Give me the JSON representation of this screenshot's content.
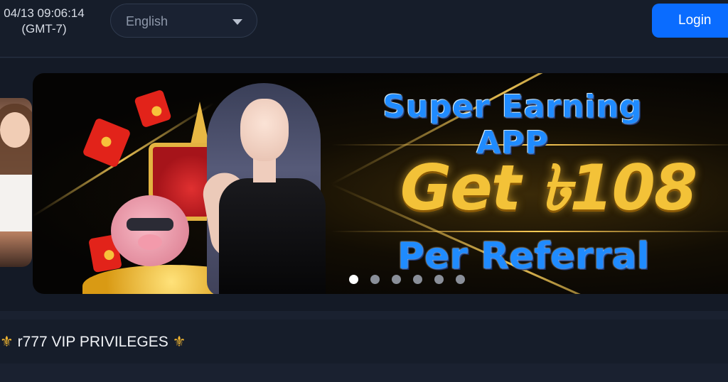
{
  "header": {
    "datetime": "04/13 09:06:14",
    "timezone": "(GMT-7)",
    "language_selected": "English",
    "login_label": "Login"
  },
  "banner": {
    "headline": "Super Earning APP",
    "amount": "Get ৳108",
    "subline": "Per Referral",
    "slide_count": 6,
    "active_slide": 1
  },
  "vip": {
    "icon_left": "⚜",
    "label": " r777 VIP PRIVILEGES ",
    "icon_right": "⚜"
  },
  "colors": {
    "accent": "#0a6cff",
    "background": "#1a2130",
    "headline_blue": "#1f8bff",
    "gold": "#f3c238"
  }
}
